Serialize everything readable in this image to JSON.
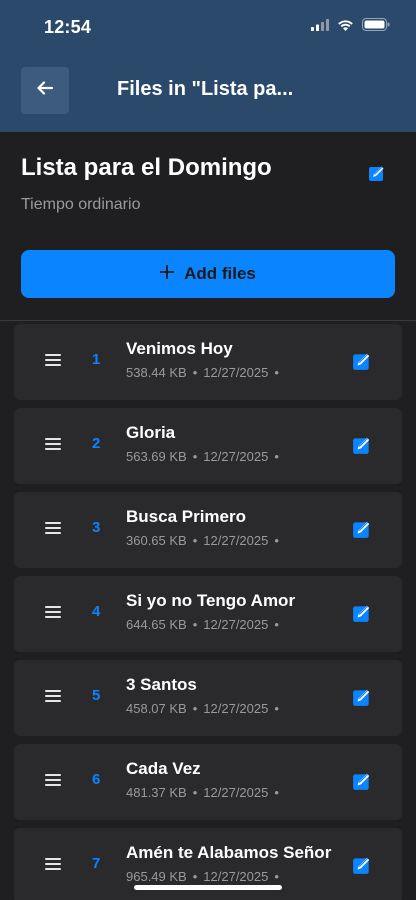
{
  "status_bar": {
    "time": "12:54"
  },
  "header": {
    "title": "Files in \"Lista pa..."
  },
  "list": {
    "title": "Lista para el Domingo",
    "subtitle": "Tiempo ordinario"
  },
  "actions": {
    "add_files_label": "Add files"
  },
  "colors": {
    "accent": "#0a84ff",
    "header_bg": "#2b4a6b",
    "background": "#1f1f21"
  },
  "files": [
    {
      "number": "1",
      "name": "Venimos Hoy",
      "size": "538.44 KB",
      "date": "12/27/2025"
    },
    {
      "number": "2",
      "name": "Gloria",
      "size": "563.69 KB",
      "date": "12/27/2025"
    },
    {
      "number": "3",
      "name": "Busca Primero",
      "size": "360.65 KB",
      "date": "12/27/2025"
    },
    {
      "number": "4",
      "name": "Si yo no Tengo Amor",
      "size": "644.65 KB",
      "date": "12/27/2025"
    },
    {
      "number": "5",
      "name": "3 Santos",
      "size": "458.07 KB",
      "date": "12/27/2025"
    },
    {
      "number": "6",
      "name": "Cada Vez",
      "size": "481.37 KB",
      "date": "12/27/2025"
    },
    {
      "number": "7",
      "name": "Amén te Alabamos Señor",
      "size": "965.49 KB",
      "date": "12/27/2025"
    }
  ]
}
